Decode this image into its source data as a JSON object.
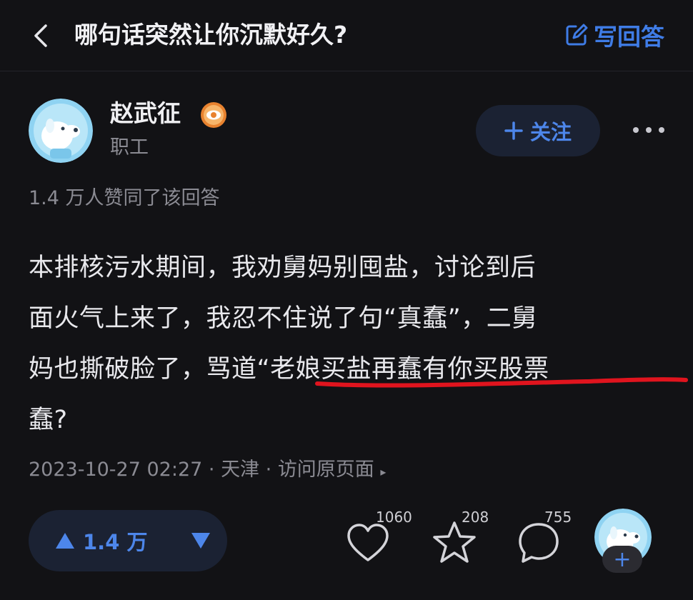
{
  "topbar": {
    "question_title": "哪句话突然让你沉默好久?",
    "write_answer_label": "写回答",
    "back_icon": "chevron-left-icon",
    "write_icon": "edit-icon"
  },
  "author": {
    "name": "赵武征",
    "role": "职工",
    "badge_icon": "eye-badge-icon",
    "follow_label": "关注"
  },
  "likes_summary": "1.4 万人赞同了该回答",
  "answer": {
    "lines": [
      "本排核污水期间，我劝舅妈别囤盐，讨论到后",
      "面火气上来了，我忍不住说了句“真蠢”，二舅",
      "妈也撕破脸了，骂道“老娘买盐再蠢有你买股票",
      "蠢?"
    ]
  },
  "meta": {
    "datetime": "2023-10-27 02:27",
    "separator": " · ",
    "location": "天津",
    "view_original": "访问原页面",
    "arrow": "▸"
  },
  "actions": {
    "upvote_count": "1.4 万",
    "like_count": "1060",
    "favorite_count": "208",
    "comment_count": "755"
  },
  "fab": {
    "plus": "+"
  },
  "colors": {
    "background": "#121215",
    "accent": "#4d86ea",
    "muted": "#8b8b93",
    "underline": "#e0141e"
  }
}
